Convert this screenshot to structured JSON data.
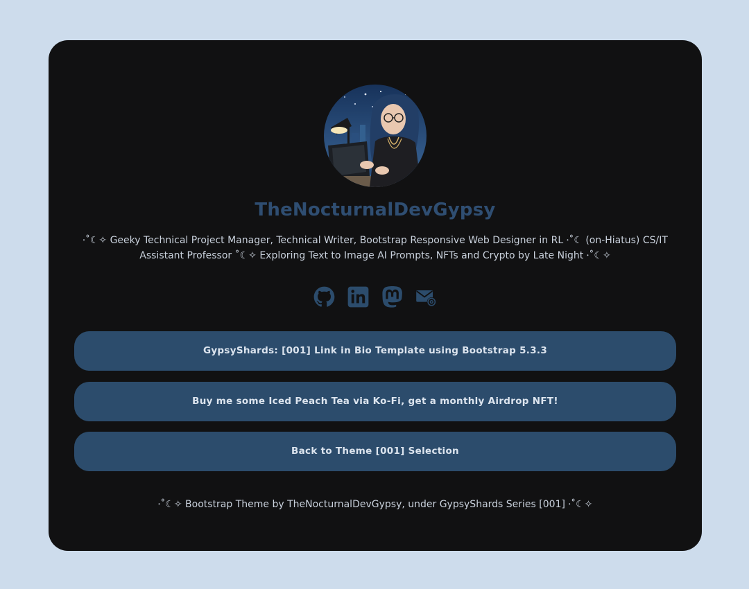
{
  "profile": {
    "name": "TheNocturnalDevGypsy",
    "bio": "⸱˚☾✧ Geeky Technical Project Manager, Technical Writer, Bootstrap Responsive Web Designer in RL ⸱˚☾ (on-Hiatus) CS/IT Assistant Professor ˚☾✧ Exploring Text to Image AI Prompts, NFTs and Crypto by Late Night ⸱˚☾✧"
  },
  "socials": [
    {
      "icon": "github-icon"
    },
    {
      "icon": "linkedin-icon"
    },
    {
      "icon": "mastodon-icon"
    },
    {
      "icon": "email-icon"
    }
  ],
  "links": [
    {
      "label": "GypsyShards: [001] Link in Bio Template using Bootstrap 5.3.3"
    },
    {
      "label": "Buy me some Iced Peach Tea via Ko-Fi, get a monthly Airdrop NFT!"
    },
    {
      "label": "Back to Theme [001] Selection"
    }
  ],
  "footer": {
    "text": "⸱˚☾✧ Bootstrap Theme by TheNocturnalDevGypsy, under GypsyShards Series [001] ⸱˚☾✧"
  },
  "colors": {
    "page_background": "#cddcec",
    "card_background": "#111112",
    "accent": "#2c4c6c",
    "name_color": "#2f4e72",
    "text": "#c9d1dc"
  }
}
